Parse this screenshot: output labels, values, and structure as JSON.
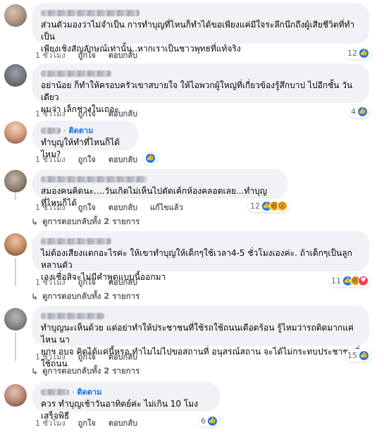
{
  "comments": [
    {
      "text": "ส่วนตัวมองว่าไม่จำเป็น การทำบุญที่ไหนก็ทำได้ขอเพียงแค่มีใจระลึกนึกถึงผู้เสียชีวิตที่ทำเป็น\nเพียงเชิงสัญลักษณ์เท่านั้น..หากเราเป็นชาวพุทธที่แท้จริง",
      "time": "1 ชั่วโมง",
      "like": "ถูกใจ",
      "reply": "ตอบกลับ",
      "reaction_count": "12",
      "reactions": [
        "like"
      ]
    },
    {
      "text": "อย่าน้อย ก็ทำให้ครอบครัวเขาสบายใจ ให้ไอพวกผู้ใหญ่ที่เกี่ยวข้องรู้สึกบาป ไปอีกชั้น วันเดียว\nผมว่า เล็กช่างในเถอะ",
      "time": "1 ชั่วโมง",
      "like": "ถูกใจ",
      "reply": "ตอบกลับ",
      "reaction_count": "4",
      "reactions": [
        "like"
      ]
    },
    {
      "follow": "ติดตาม",
      "text": "ทำบุญให้ทำที่ไหนก็ได้ไหม?",
      "time": "1 ชั่วโมง",
      "like": "ถูกใจ",
      "reply": "ตอบกลับ",
      "reaction_count": "",
      "reactions": [
        "like"
      ]
    },
    {
      "text": "สมองคนคิดนะ....วันเกิดไม่เห็นไปตัดเค้กห้องคลอดเลย...ทำบุญที่ไหนก็ได้",
      "time": "1 ชั่วโมง",
      "like": "ถูกใจ",
      "reply": "ตอบกลับ",
      "edited": "แก้ไขแล้ว",
      "reaction_count": "12",
      "reactions": [
        "like",
        "haha",
        "wow"
      ],
      "view_replies": "ดูการตอบกลับทั้ง 2 รายการ"
    },
    {
      "text": "ไม่ต้องเสียงแตกอะไรค่ะ ให้เขาทำบุญให้เด็กๆใช้เวลา4-5 ชั่วโมงเองค่ะ. ถ้าเด็กๆเป็นลูกหลานตัว\nเองเชื่อสิจะไม่มีคำพูดแบบนี้ออกมา",
      "time": "1 ชั่วโมง",
      "like": "ถูกใจ",
      "reply": "ตอบกลับ",
      "reaction_count": "11",
      "reactions": [
        "like",
        "haha",
        "love"
      ],
      "view_replies": "ดูการตอบกลับทั้ง 2 รายการ"
    },
    {
      "text": "ทำบุญนะเห็นด้วย แต่อย่าทำให้ประชาชนที่ใช้รถใช้ถนนเดือดร้อน รู้ไหมว่ารถติดมากแค่ไหน นา\nยกฯ อบจ คิดได้แค่นี้หรอ ทำไมไม่ไปขอสถานที่ อนุสรณ์สถาน จะได้ไม่กระทบประชาชนที่ใช้ถนน",
      "time": "1 ชั่วโมง",
      "like": "ถูกใจ",
      "reply": "ตอบกลับ",
      "reaction_count": "15",
      "reactions": [
        "like"
      ],
      "view_replies": "ดูการตอบกลับทั้ง 2 รายการ"
    },
    {
      "follow": "ติดตาม",
      "text": "ควร ทำบุญเช้าวันอาทิตย์ค่ะ ไม่เกิน 10 โมง เสร็จพิธี",
      "time": "1 ชั่วโมง",
      "like": "ถูกใจ",
      "reply": "ตอบกลับ",
      "reaction_count": "6",
      "reactions": [
        "like"
      ]
    }
  ],
  "colors": {
    "bubble": "#f0f2f5",
    "meta_text": "#65676b",
    "link_blue": "#1b74e4",
    "like_blue": "#1877f2",
    "love_red": "#f33e58",
    "haha_yellow": "#f7b125"
  },
  "icons": {
    "like": "thumbs-up-icon",
    "haha": "laughing-face-icon",
    "wow": "surprised-face-icon",
    "love": "heart-icon",
    "reply_arrow": "reply-arrow-icon"
  }
}
